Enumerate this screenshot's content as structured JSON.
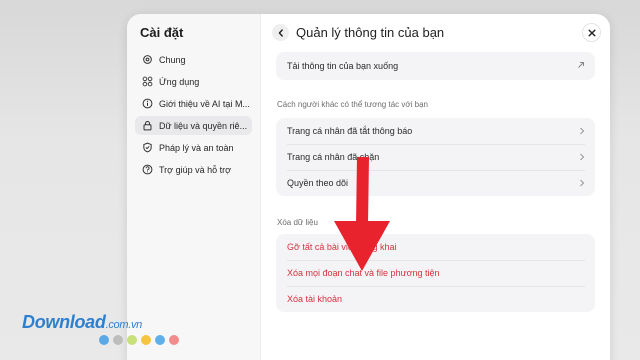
{
  "sidebar": {
    "title": "Cài đặt",
    "items": [
      {
        "label": "Chung",
        "icon": "gear-icon"
      },
      {
        "label": "Ứng dụng",
        "icon": "apps-grid-icon"
      },
      {
        "label": "Giới thiệu về AI tại M...",
        "icon": "info-icon"
      },
      {
        "label": "Dữ liệu và quyền riê...",
        "icon": "lock-icon",
        "active": true
      },
      {
        "label": "Pháp lý và an toàn",
        "icon": "shield-check-icon"
      },
      {
        "label": "Trợ giúp và hỗ trợ",
        "icon": "help-icon"
      }
    ]
  },
  "main": {
    "title": "Quản lý thông tin của bạn",
    "download": {
      "label": "Tải thông tin của bạn xuống"
    },
    "interaction_section": {
      "label": "Cách người khác có thể tương tác với bạn",
      "rows": [
        {
          "label": "Trang cá nhân đã tắt thông báo"
        },
        {
          "label": "Trang cá nhân đã chặn"
        },
        {
          "label": "Quyền theo dõi"
        }
      ]
    },
    "delete_section": {
      "label": "Xóa dữ liệu",
      "rows": [
        {
          "label": "Gỡ tất cả bài viết công khai"
        },
        {
          "label": "Xóa mọi đoạn chat và file phương tiện"
        },
        {
          "label": "Xóa tài khoản"
        }
      ]
    }
  },
  "watermark": {
    "brand": "Download",
    "domain": ".com.vn",
    "dot_colors": [
      "#5aa9e6",
      "#bdbdbd",
      "#c6e07a",
      "#f5c542",
      "#5fb0e8",
      "#f08c8c"
    ]
  },
  "colors": {
    "accent_red": "#d9303e",
    "annotation_arrow": "#e8232e"
  }
}
